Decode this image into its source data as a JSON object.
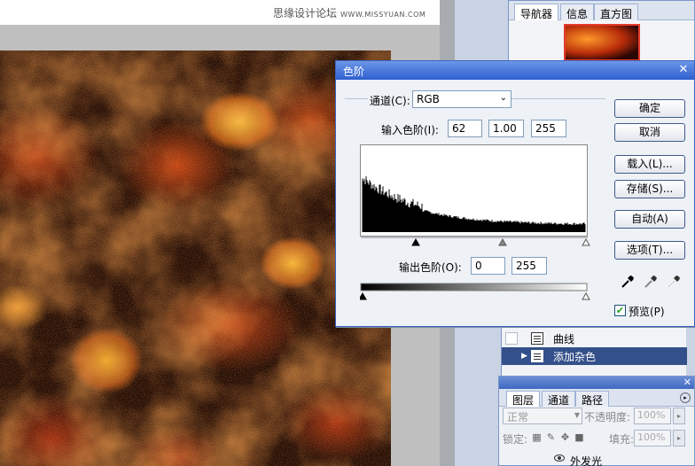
{
  "watermark": {
    "text": "思缘设计论坛",
    "url": "WWW.MISSYUAN.COM"
  },
  "navigator_panel": {
    "tabs": [
      {
        "label": "导航器",
        "active": true
      },
      {
        "label": "信息",
        "active": false
      },
      {
        "label": "直方图",
        "active": false
      }
    ]
  },
  "actions_panel": {
    "items": [
      {
        "label": "曲线",
        "selected": false
      },
      {
        "label": "添加杂色",
        "selected": true
      }
    ]
  },
  "layers_panel": {
    "tabs": [
      {
        "label": "图层",
        "active": true
      },
      {
        "label": "通道",
        "active": false
      },
      {
        "label": "路径",
        "active": false
      }
    ],
    "blend_mode": "正常",
    "opacity_label": "不透明度:",
    "opacity_value": "100%",
    "lock_label": "锁定:",
    "fill_label": "填充:",
    "fill_value": "100%",
    "layer_item": "外发光"
  },
  "levels_dialog": {
    "title": "色阶",
    "channel_label": "通道(C):",
    "channel_value": "RGB",
    "input_levels_label": "输入色阶(I):",
    "input_black": "62",
    "input_gamma": "1.00",
    "input_white": "255",
    "output_levels_label": "输出色阶(O):",
    "output_black": "0",
    "output_white": "255",
    "buttons": {
      "ok": "确定",
      "cancel": "取消",
      "load": "载入(L)...",
      "save": "存储(S)...",
      "auto": "自动(A)",
      "options": "选项(T)..."
    },
    "preview_label": "预览(P)",
    "preview_checked": true
  },
  "colors": {
    "titlebar": "#2e5fcf",
    "selection": "#34508a",
    "fire_bright": "#ffd23c",
    "fire_dark": "#1a0503"
  }
}
